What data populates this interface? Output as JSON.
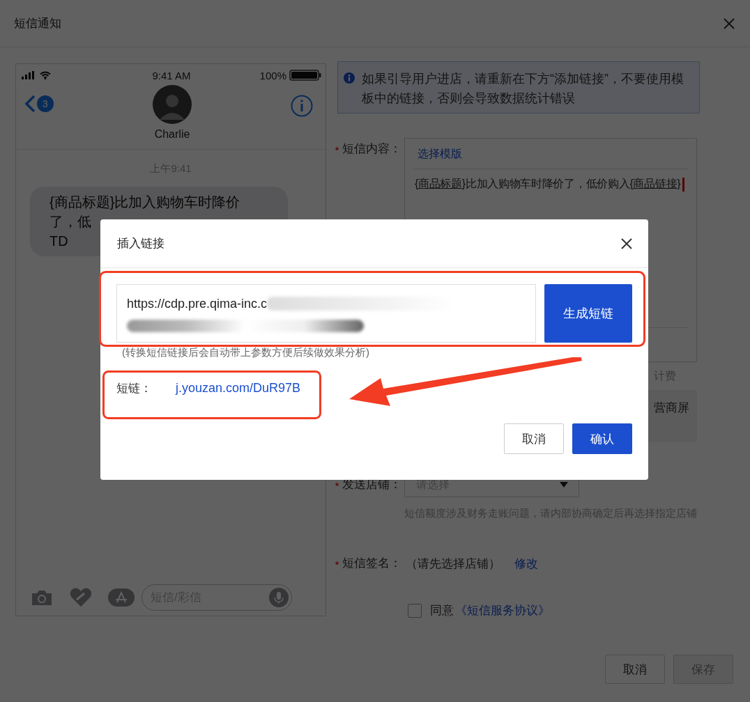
{
  "dialog": {
    "title": "短信通知"
  },
  "phone": {
    "time": "9:41 AM",
    "battery": "100%",
    "badge": "3",
    "contact": "Charlie",
    "timestamp": "上午9:41",
    "bubble_lines": [
      "{商品标题}比加入购物车时降价",
      "了，低",
      "TD"
    ],
    "input": {
      "placeholder": "短信/彩信"
    }
  },
  "notice": {
    "text": "如果引导用户进店，请重新在下方“添加链接”，不要使用模板中的链接，否则会导致数据统计错误"
  },
  "form": {
    "content": {
      "label": "短信内容：",
      "required": true,
      "template_link": "选择模版",
      "segments": [
        {
          "kind": "token",
          "text": "{商品标题}"
        },
        {
          "kind": "text",
          "text": "比加入购物车时降价了，低价购入"
        },
        {
          "kind": "token",
          "text": "{商品链接}"
        }
      ],
      "cursor": true
    },
    "fee_fragment": "计费",
    "box_fragment": "营商屏",
    "shop": {
      "label": "发送店铺：",
      "required": true,
      "placeholder": "请选择",
      "hint": "短信额度涉及财务走账问题，请内部协商确定后再选择指定店铺"
    },
    "signature": {
      "label": "短信签名：",
      "required": true,
      "value": "（请先选择店铺）",
      "link": "修改"
    },
    "agreement": {
      "checked": false,
      "text": "同意",
      "link": "《短信服务协议》"
    }
  },
  "footer": [
    {
      "label": "取消",
      "disabled": false
    },
    {
      "label": "保存",
      "disabled": true
    }
  ],
  "modal": {
    "title": "插入链接",
    "url_value": "https://cdp.pre.qima-inc.c",
    "generate_button": "生成短链",
    "hint": "(转换短信链接后会自动带上参数方便后续做效果分析)",
    "short_link_label": "短链：",
    "short_link": "j.youzan.com/DuR97B",
    "buttons": [
      {
        "label": "取消",
        "kind": "secondary"
      },
      {
        "label": "确认",
        "kind": "primary"
      }
    ]
  }
}
